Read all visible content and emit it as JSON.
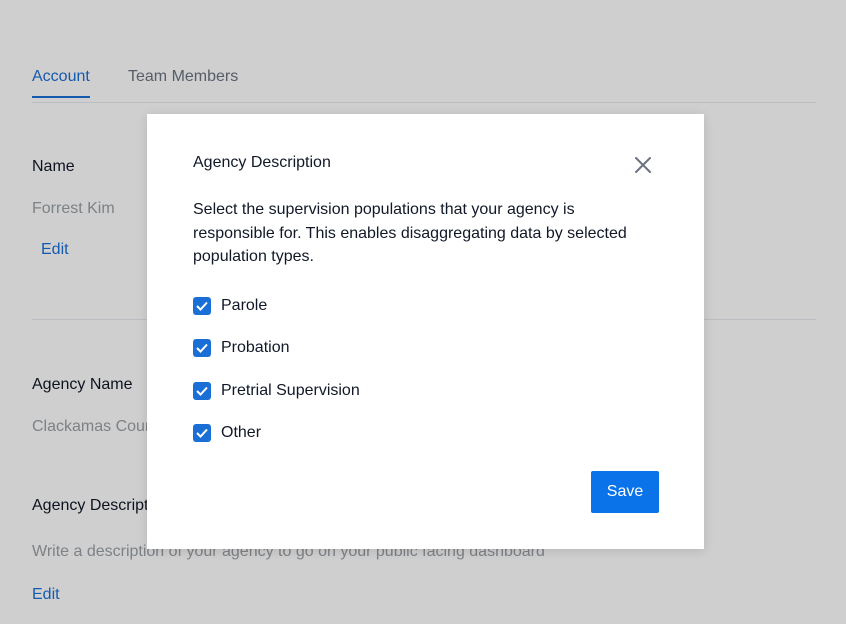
{
  "tabs": [
    {
      "label": "Account"
    },
    {
      "label": "Team Members"
    }
  ],
  "account": {
    "name_title": "Name",
    "name_value": "Forrest Kim",
    "name_edit": "Edit",
    "agency_name_title": "Agency Name",
    "agency_name_value": "Clackamas County",
    "agency_desc_title": "Agency Description",
    "agency_desc_value": "Write a description of your agency to go on your public facing dashboard",
    "agency_desc_edit": "Edit"
  },
  "modal": {
    "title": "Agency Description",
    "close_icon": "close-icon",
    "description": "Select the supervision populations that your agency is responsible for. This enables disaggregating data by selected population types.",
    "options": [
      {
        "label": "Parole",
        "checked": true
      },
      {
        "label": "Probation",
        "checked": true
      },
      {
        "label": "Pretrial Supervision",
        "checked": true
      },
      {
        "label": "Other",
        "checked": true
      }
    ],
    "save_label": "Save"
  },
  "colors": {
    "accent": "#1a6fd6",
    "button": "#0b73ea",
    "overlay": "rgba(0,0,0,0.19)"
  }
}
